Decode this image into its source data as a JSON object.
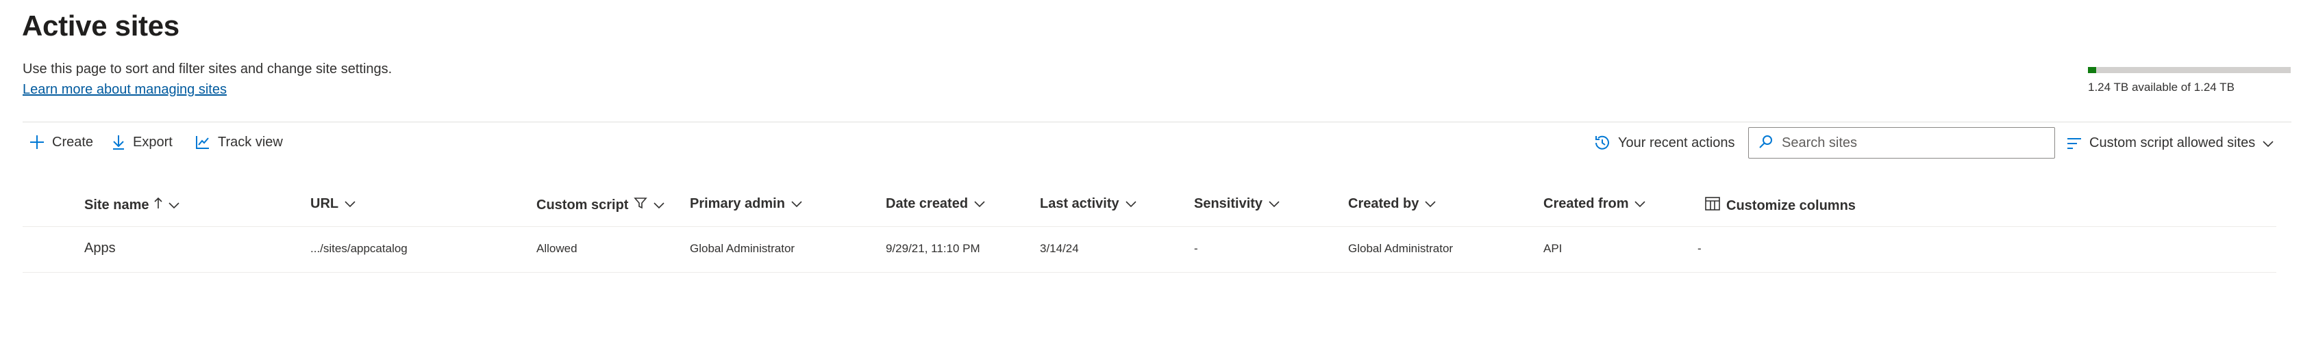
{
  "page": {
    "title": "Active sites",
    "description": "Use this page to sort and filter sites and change site settings.",
    "learn_more": "Learn more about managing sites"
  },
  "storage": {
    "used_fraction": 0.04,
    "text": "1.24 TB available of 1.24 TB",
    "fill_color": "#107c10"
  },
  "toolbar": {
    "create": "Create",
    "export": "Export",
    "track_view": "Track view",
    "recent_actions": "Your recent actions",
    "search_placeholder": "Search sites",
    "view_filter": "Custom script allowed sites"
  },
  "table": {
    "columns": {
      "site_name": "Site name",
      "url": "URL",
      "custom_script": "Custom script",
      "primary_admin": "Primary admin",
      "date_created": "Date created",
      "last_activity": "Last activity",
      "sensitivity": "Sensitivity",
      "created_by": "Created by",
      "created_from": "Created from",
      "customize": "Customize columns"
    },
    "rows": [
      {
        "site_name": "Apps",
        "url": ".../sites/appcatalog",
        "custom_script": "Allowed",
        "primary_admin": "Global Administrator",
        "date_created": "9/29/21, 11:10 PM",
        "last_activity": "3/14/24",
        "sensitivity": "-",
        "created_by": "Global Administrator",
        "created_from": "API",
        "extra": "-"
      }
    ]
  },
  "colors": {
    "accent": "#0078d4",
    "link": "#005a9e"
  }
}
